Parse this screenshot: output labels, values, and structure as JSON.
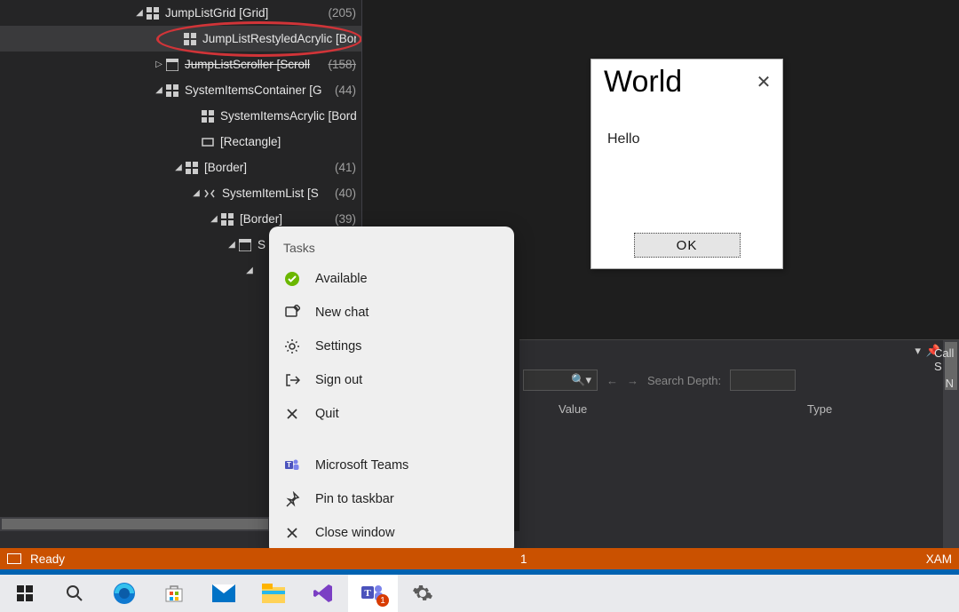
{
  "tree": {
    "rows": [
      {
        "indent": 150,
        "expander": "down",
        "glyph": "grid",
        "label": "JumpListGrid [Grid]",
        "count": "(205)",
        "selected": false
      },
      {
        "indent": 192,
        "expander": "none",
        "glyph": "grid",
        "label": "JumpListRestyledAcrylic [Borde",
        "count": "",
        "selected": true
      },
      {
        "indent": 172,
        "expander": "right",
        "glyph": "panel",
        "label": "JumpListScroller [Scroll",
        "count": "(158)",
        "selected": false,
        "strike": true
      },
      {
        "indent": 172,
        "expander": "down",
        "glyph": "grid",
        "label": "SystemItemsContainer [G",
        "count": "(44)",
        "selected": false
      },
      {
        "indent": 212,
        "expander": "none",
        "glyph": "grid",
        "label": "SystemItemsAcrylic [Border",
        "count": "",
        "selected": false
      },
      {
        "indent": 212,
        "expander": "none",
        "glyph": "rect",
        "label": "[Rectangle]",
        "count": "",
        "selected": false
      },
      {
        "indent": 194,
        "expander": "down",
        "glyph": "grid",
        "label": "[Border]",
        "count": "(41)",
        "selected": false
      },
      {
        "indent": 214,
        "expander": "down",
        "glyph": "tags",
        "label": "SystemItemList [S",
        "count": "(40)",
        "selected": false
      },
      {
        "indent": 234,
        "expander": "down",
        "glyph": "grid",
        "label": "[Border]",
        "count": "(39)",
        "selected": false
      },
      {
        "indent": 254,
        "expander": "down",
        "glyph": "panel",
        "label": "S",
        "count": "",
        "selected": false
      },
      {
        "indent": 274,
        "expander": "down",
        "glyph": "none",
        "label": "",
        "count": "",
        "selected": false
      }
    ]
  },
  "jumplist": {
    "header": "Tasks",
    "items": [
      {
        "icon": "status-available",
        "label": "Available"
      },
      {
        "icon": "new-chat",
        "label": "New chat"
      },
      {
        "icon": "settings",
        "label": "Settings"
      },
      {
        "icon": "sign-out",
        "label": "Sign out"
      },
      {
        "icon": "quit",
        "label": "Quit"
      }
    ],
    "bottom": [
      {
        "icon": "teams",
        "label": "Microsoft Teams"
      },
      {
        "icon": "pin",
        "label": "Pin to taskbar"
      },
      {
        "icon": "close-window",
        "label": "Close window"
      }
    ]
  },
  "dialog": {
    "title": "World",
    "body": "Hello",
    "ok": "OK"
  },
  "toolpanel": {
    "searchLabel": "Search Depth:",
    "col1": "Value",
    "col2": "Type"
  },
  "sidetab": {
    "label1": "Call S",
    "label2": "N"
  },
  "orange": {
    "ready": "Ready",
    "breakNum": "1",
    "right": "XAM"
  },
  "taskbar": {
    "badge": "1"
  }
}
